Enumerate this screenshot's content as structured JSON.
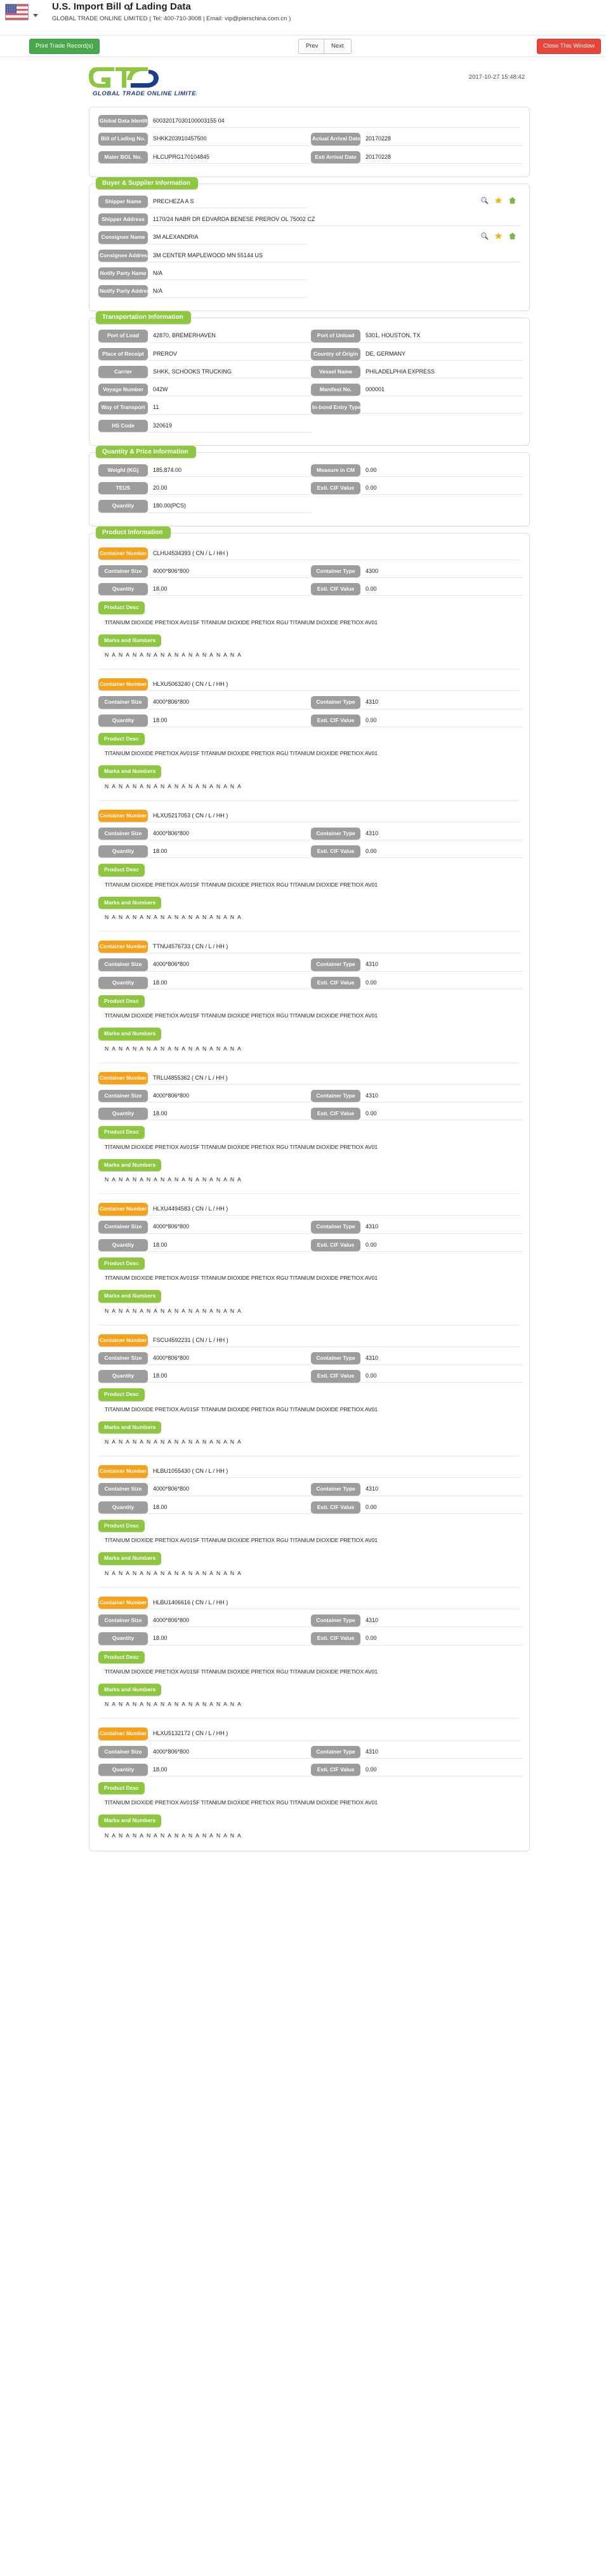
{
  "header": {
    "flag_icon": "us-flag-icon",
    "title": "U.S. Import Bill of Lading Data",
    "subtitle": "GLOBAL TRADE ONLINE LIMITED ( Tel: 400-710-3008 | Email: vip@pierschina.com.cn )"
  },
  "toolbar": {
    "print_label": "Print Trade Record(s)",
    "prev_label": "Prev",
    "next_label": "Next",
    "close_label": "Close This Window"
  },
  "document": {
    "logo_text": "GLOBAL TRADE ONLINE LIMITED",
    "logo_mark": "GTO",
    "timestamp": "2017-10-27 15:48:42"
  },
  "identity": {
    "rows": [
      {
        "label": "Global Data Identity",
        "value": "60032017030100003155 04"
      },
      {
        "label": "Bill of Lading No.",
        "value": "SHKK203910457500",
        "label2": "Actual Arrival Date",
        "value2": "20170228"
      },
      {
        "label": "Mater BOL No.",
        "value": "HLCUPRG170104845",
        "label2": "Esti Arrival Date",
        "value2": "20170228"
      }
    ]
  },
  "buyer_supplier": {
    "legend": "Buyer & Supplier Information",
    "rows": [
      {
        "label": "Shipper Name",
        "value": "PRECHEZA A S",
        "has_icons": true
      },
      {
        "label": "Shipper Address",
        "value": "1170/24 NABR DR EDVARDA BENESE PREROV OL 75002 CZ",
        "has_icons": false
      },
      {
        "label": "Consignee Name",
        "value": "3M ALEXANDRIA",
        "has_icons": true
      },
      {
        "label": "Consignee Address",
        "value": "3M CENTER MAPLEWOOD MN 55144 US",
        "has_icons": false
      },
      {
        "label": "Notify Party Name",
        "value": "N/A",
        "has_icons": false
      },
      {
        "label": "Notify Party Address",
        "value": "N/A",
        "has_icons": false
      }
    ],
    "icons": [
      "search-icon",
      "star-icon",
      "home-icon"
    ]
  },
  "transportation": {
    "legend": "Transportation Information",
    "rows": [
      {
        "label": "Port of Load",
        "value": "42870, BREMERHAVEN",
        "label2": "Port of Unload",
        "value2": "5301, HOUSTON, TX"
      },
      {
        "label": "Place of Receipt",
        "value": "PREROV",
        "label2": "Country of Origin",
        "value2": "DE, GERMANY"
      },
      {
        "label": "Carrier",
        "value": "SHKK, SCHOOKS TRUCKING",
        "label2": "Vessel Name",
        "value2": "PHILADELPHIA EXPRESS"
      },
      {
        "label": "Voyage Number",
        "value": "042W",
        "label2": "Manifest No.",
        "value2": "000001"
      },
      {
        "label": "Way of Transport",
        "value": "11",
        "label2": "In-bond Entry Type",
        "value2": ""
      },
      {
        "label": "HS Code",
        "value": "320619",
        "label2": "",
        "value2": ""
      }
    ]
  },
  "quantity_price": {
    "legend": "Quantity & Price Information",
    "rows": [
      {
        "label": "Weight (KG)",
        "value": "185,874.00",
        "label2": "Measure in CM",
        "value2": "0.00"
      },
      {
        "label": "TEUS",
        "value": "20.00",
        "label2": "Esti. CIF Value",
        "value2": "0.00"
      },
      {
        "label": "Quantity",
        "value": "180.00(PCS)",
        "label2": "",
        "value2": ""
      }
    ]
  },
  "product": {
    "legend": "Product Information",
    "labels": {
      "container_number": "Container Number",
      "container_size": "Container Size",
      "container_type": "Container Type",
      "quantity": "Quantity",
      "esti_cif_value": "Esti. CIF Value",
      "product_desc": "Product Desc",
      "marks_and_numbers": "Marks and Numbers"
    },
    "items": [
      {
        "container_number": "CLHU4534393 ( CN / L / HH )",
        "container_size": "4000*806*800",
        "container_type": "4300",
        "quantity": "18.00",
        "esti_cif_value": "0.00",
        "desc": "TITANIUM DIOXIDE PRETIOX AV01SF TITANIUM DIOXIDE PRETIOX RGU TITANIUM DIOXIDE PRETIOX AV01",
        "marks": "N A N A N A N A N A N A N A N A N A N A"
      },
      {
        "container_number": "HLXU5063240 ( CN / L / HH )",
        "container_size": "4000*806*800",
        "container_type": "4310",
        "quantity": "18.00",
        "esti_cif_value": "0.00",
        "desc": "TITANIUM DIOXIDE PRETIOX AV01SF TITANIUM DIOXIDE PRETIOX RGU TITANIUM DIOXIDE PRETIOX AV01",
        "marks": "N A N A N A N A N A N A N A N A N A N A"
      },
      {
        "container_number": "HLXU5217053 ( CN / L / HH )",
        "container_size": "4000*806*800",
        "container_type": "4310",
        "quantity": "18.00",
        "esti_cif_value": "0.00",
        "desc": "TITANIUM DIOXIDE PRETIOX AV01SF TITANIUM DIOXIDE PRETIOX RGU TITANIUM DIOXIDE PRETIOX AV01",
        "marks": "N A N A N A N A N A N A N A N A N A N A"
      },
      {
        "container_number": "TTNU4576733 ( CN / L / HH )",
        "container_size": "4000*806*800",
        "container_type": "4310",
        "quantity": "18.00",
        "esti_cif_value": "0.00",
        "desc": "TITANIUM DIOXIDE PRETIOX AV01SF TITANIUM DIOXIDE PRETIOX RGU TITANIUM DIOXIDE PRETIOX AV01",
        "marks": "N A N A N A N A N A N A N A N A N A N A"
      },
      {
        "container_number": "TRLU4855362 ( CN / L / HH )",
        "container_size": "4000*806*800",
        "container_type": "4310",
        "quantity": "18.00",
        "esti_cif_value": "0.00",
        "desc": "TITANIUM DIOXIDE PRETIOX AV01SF TITANIUM DIOXIDE PRETIOX RGU TITANIUM DIOXIDE PRETIOX AV01",
        "marks": "N A N A N A N A N A N A N A N A N A N A"
      },
      {
        "container_number": "HLXU4494583 ( CN / L / HH )",
        "container_size": "4000*806*800",
        "container_type": "4310",
        "quantity": "18.00",
        "esti_cif_value": "0.00",
        "desc": "TITANIUM DIOXIDE PRETIOX AV01SF TITANIUM DIOXIDE PRETIOX RGU TITANIUM DIOXIDE PRETIOX AV01",
        "marks": "N A N A N A N A N A N A N A N A N A N A"
      },
      {
        "container_number": "FSCU4592231 ( CN / L / HH )",
        "container_size": "4000*806*800",
        "container_type": "4310",
        "quantity": "18.00",
        "esti_cif_value": "0.00",
        "desc": "TITANIUM DIOXIDE PRETIOX AV01SF TITANIUM DIOXIDE PRETIOX RGU TITANIUM DIOXIDE PRETIOX AV01",
        "marks": "N A N A N A N A N A N A N A N A N A N A"
      },
      {
        "container_number": "HLBU1055430 ( CN / L / HH )",
        "container_size": "4000*806*800",
        "container_type": "4310",
        "quantity": "18.00",
        "esti_cif_value": "0.00",
        "desc": "TITANIUM DIOXIDE PRETIOX AV01SF TITANIUM DIOXIDE PRETIOX RGU TITANIUM DIOXIDE PRETIOX AV01",
        "marks": "N A N A N A N A N A N A N A N A N A N A"
      },
      {
        "container_number": "HLBU1406616 ( CN / L / HH )",
        "container_size": "4000*806*800",
        "container_type": "4310",
        "quantity": "18.00",
        "esti_cif_value": "0.00",
        "desc": "TITANIUM DIOXIDE PRETIOX AV01SF TITANIUM DIOXIDE PRETIOX RGU TITANIUM DIOXIDE PRETIOX AV01",
        "marks": "N A N A N A N A N A N A N A N A N A N A"
      },
      {
        "container_number": "HLXU5132172 ( CN / L / HH )",
        "container_size": "4000*806*800",
        "container_type": "4310",
        "quantity": "18.00",
        "esti_cif_value": "0.00",
        "desc": "TITANIUM DIOXIDE PRETIOX AV01SF TITANIUM DIOXIDE PRETIOX RGU TITANIUM DIOXIDE PRETIOX AV01",
        "marks": "N A N A N A N A N A N A N A N A N A N A"
      }
    ]
  },
  "colors": {
    "green": "#8dc63f",
    "orange": "#f7a11a",
    "gray": "#9d9d9d",
    "print_btn": "#49a84c",
    "close_btn": "#e8453c"
  }
}
